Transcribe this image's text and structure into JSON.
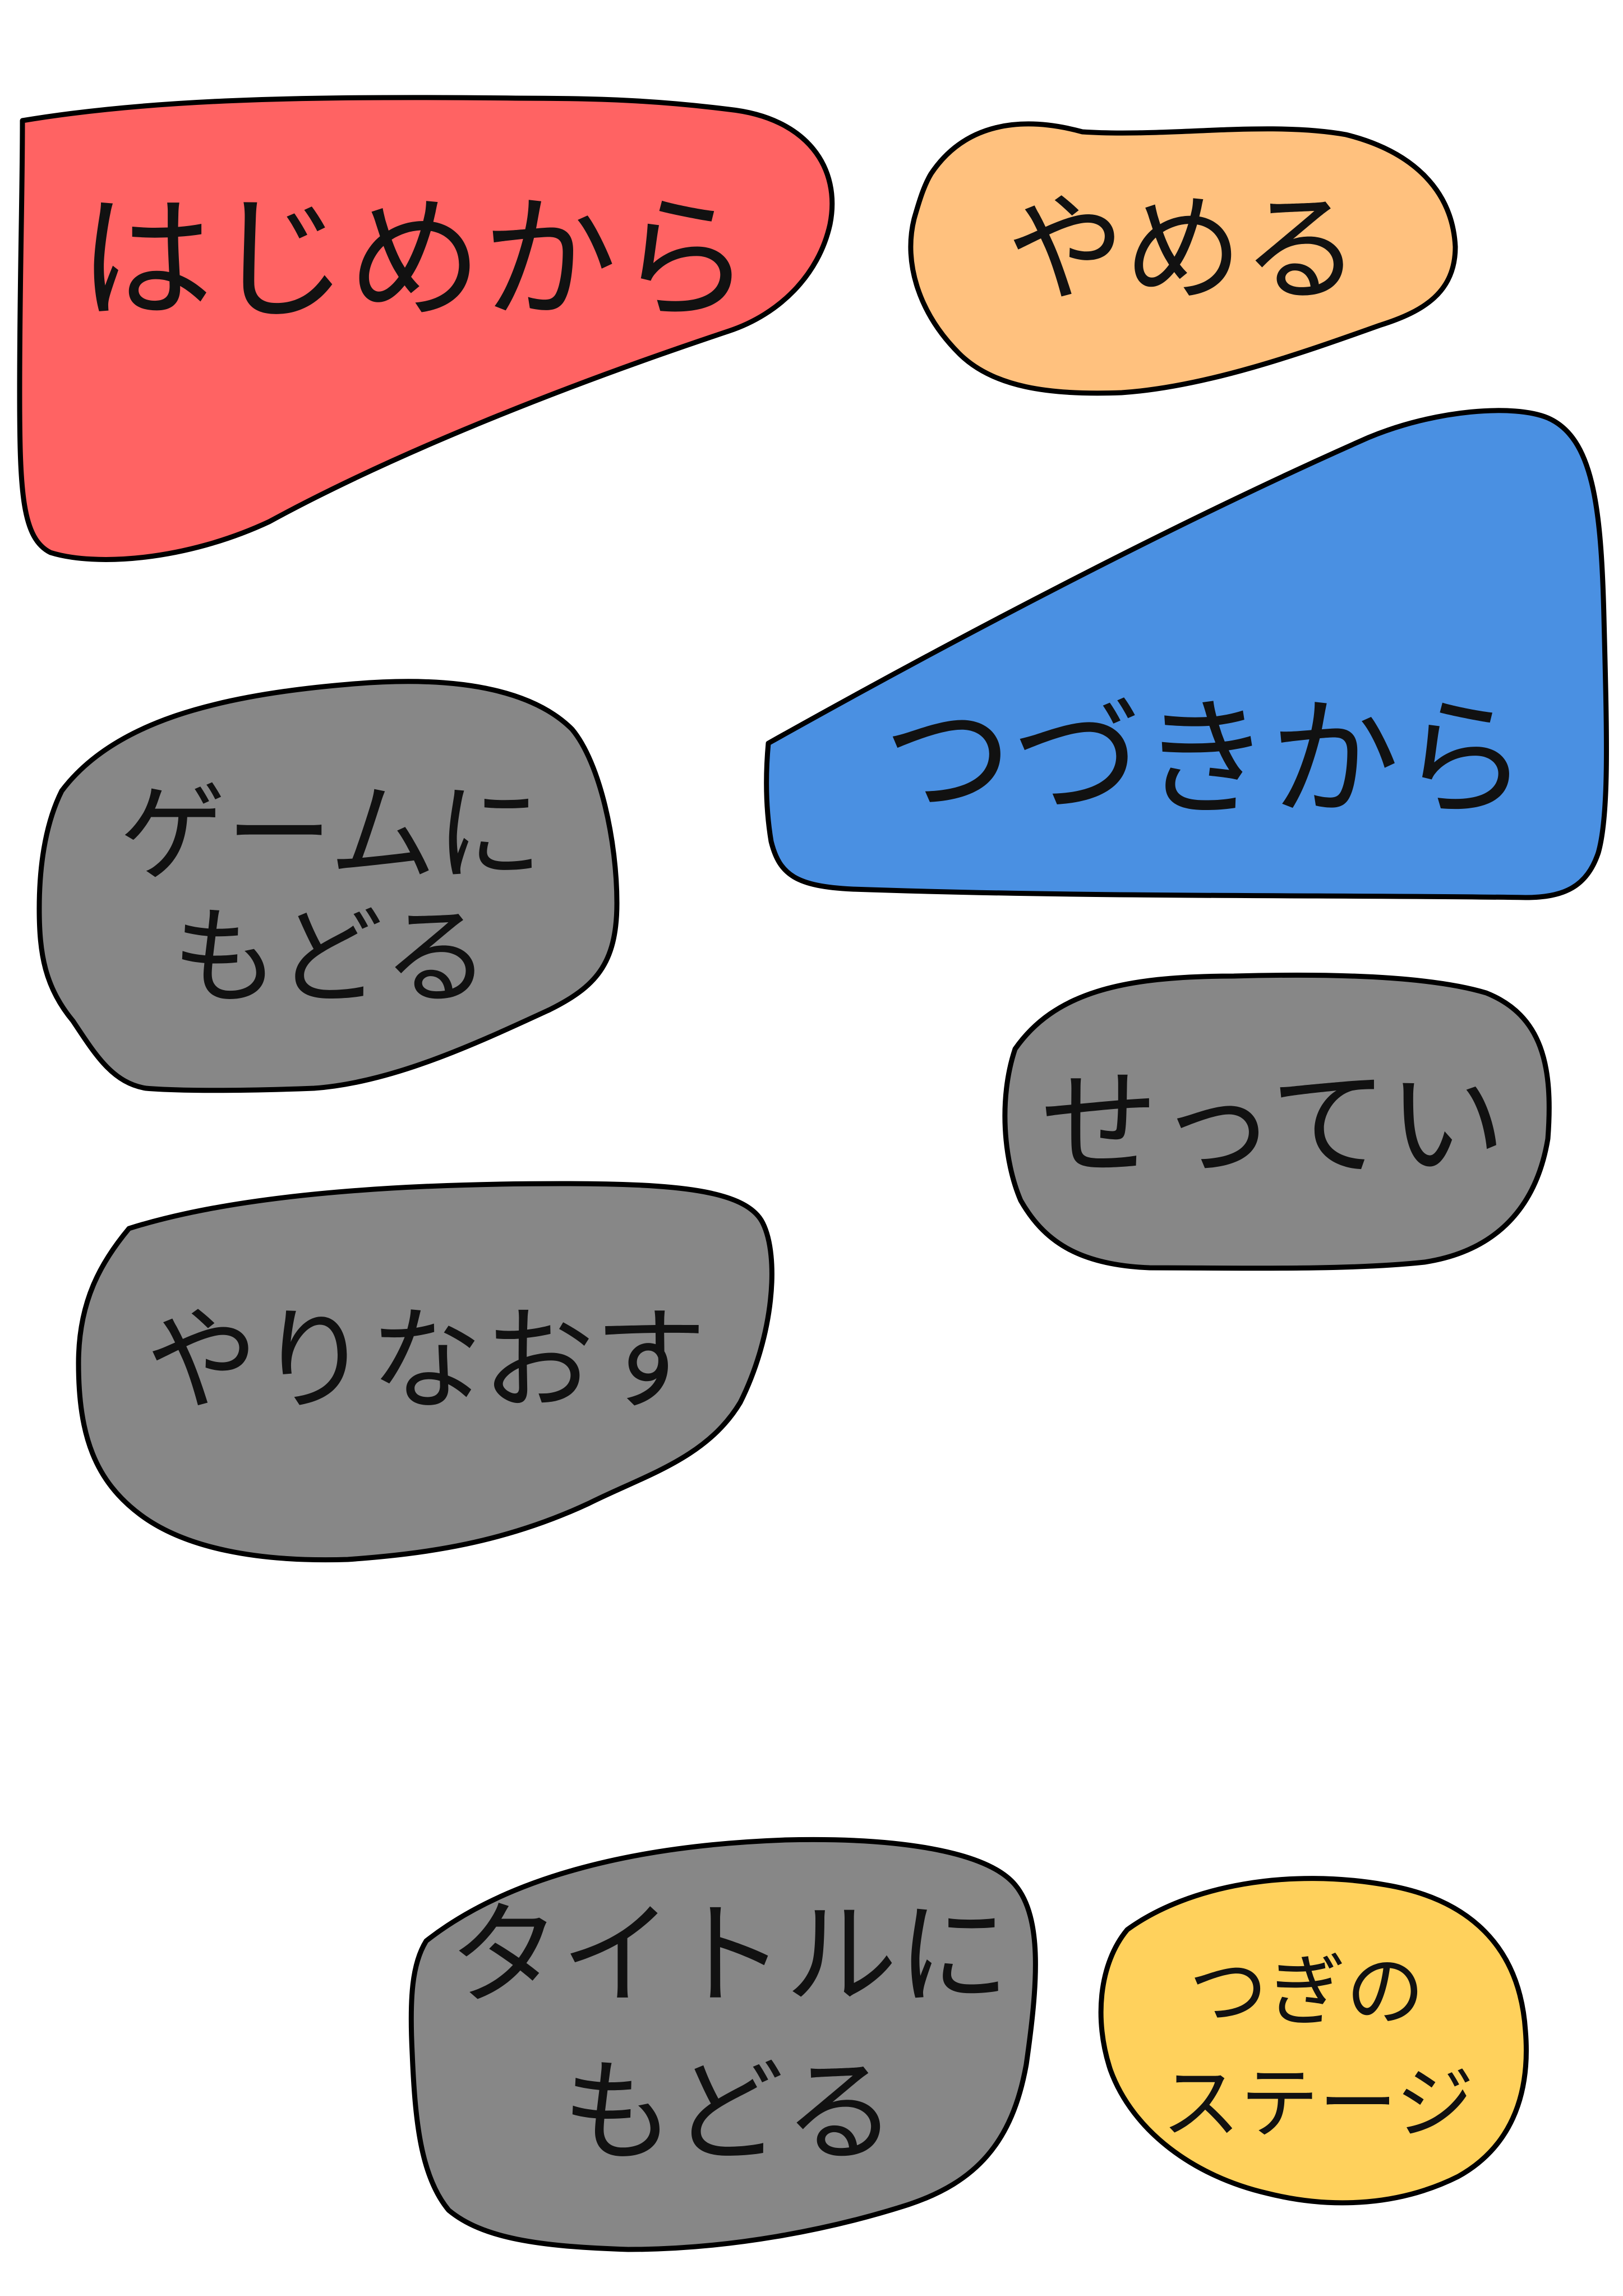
{
  "menu": {
    "start_new": {
      "label": "はじめから",
      "color": "#FF6363"
    },
    "quit": {
      "label": "やめる",
      "color": "#FFC17E"
    },
    "continue": {
      "label": "つづきから",
      "color": "#4A90E2"
    },
    "back_to_game": {
      "line1": "ゲームに",
      "line2": "もどる",
      "color": "#878787"
    },
    "settings": {
      "label": "せってい",
      "color": "#878787"
    },
    "retry": {
      "label": "やりなおす",
      "color": "#878787"
    },
    "back_to_title": {
      "line1": "タイトルに",
      "line2": "もどる",
      "color": "#878787"
    },
    "next_stage": {
      "line1": "つぎの",
      "line2": "ステージ",
      "color": "#FFD15C"
    }
  }
}
